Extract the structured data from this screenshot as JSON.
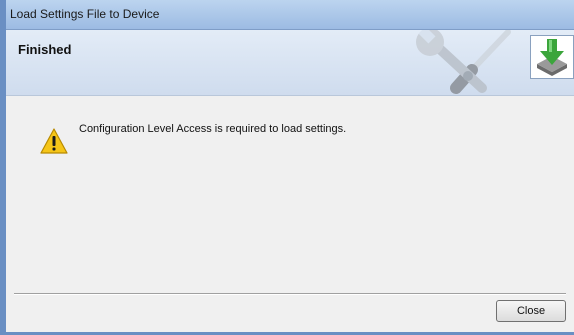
{
  "window": {
    "title": "Load Settings File to Device"
  },
  "header": {
    "heading": "Finished",
    "decor_icon": "wrench-screwdriver-icon",
    "step_icon": "download-to-device-icon"
  },
  "content": {
    "message_icon": "warning-icon",
    "message": "Configuration Level Access is required to load settings."
  },
  "footer": {
    "close_label": "Close"
  },
  "colors": {
    "titlebar": "#9cbbe3",
    "header_bg": "#dce6f2",
    "body_bg": "#f0f0f0",
    "download_arrow": "#3ba53b",
    "warning": "#f5c518"
  }
}
